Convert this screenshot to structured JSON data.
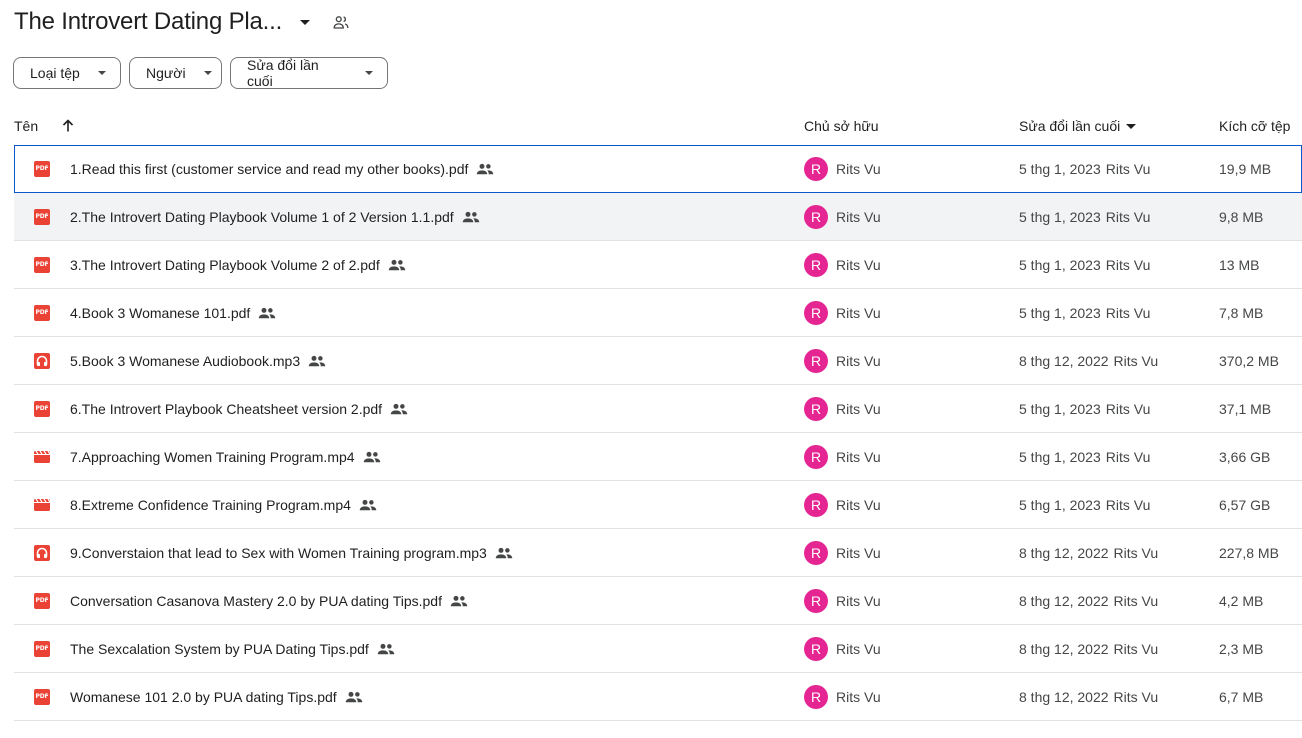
{
  "folder": {
    "title": "The Introvert Dating Pla...",
    "title_caret_icon": "arrow-drop-down-icon",
    "shared_icon": "shared-people-icon"
  },
  "filters": [
    {
      "label": "Loại tệp"
    },
    {
      "label": "Người"
    },
    {
      "label": "Sửa đổi lần cuối"
    }
  ],
  "columns": {
    "name": "Tên",
    "owner": "Chủ sở hữu",
    "modified": "Sửa đổi lần cuối",
    "size": "Kích cỡ tệp"
  },
  "colors": {
    "pdf": "#ea4335",
    "audio": "#ea4335",
    "video": "#ea4335",
    "avatar": "#e52592",
    "selection": "#0b57d0"
  },
  "files": [
    {
      "name": "1.Read this first (customer service and read my other books).pdf",
      "type": "pdf",
      "owner_initial": "R",
      "owner": "Rits Vu",
      "modified_date": "5 thg 1, 2023",
      "modified_by": "Rits Vu",
      "size": "19,9 MB"
    },
    {
      "name": "2.The Introvert Dating Playbook Volume 1 of 2 Version 1.1.pdf",
      "type": "pdf",
      "owner_initial": "R",
      "owner": "Rits Vu",
      "modified_date": "5 thg 1, 2023",
      "modified_by": "Rits Vu",
      "size": "9,8 MB"
    },
    {
      "name": "3.The Introvert Dating Playbook Volume 2 of 2.pdf",
      "type": "pdf",
      "owner_initial": "R",
      "owner": "Rits Vu",
      "modified_date": "5 thg 1, 2023",
      "modified_by": "Rits Vu",
      "size": "13 MB"
    },
    {
      "name": "4.Book 3 Womanese 101.pdf",
      "type": "pdf",
      "owner_initial": "R",
      "owner": "Rits Vu",
      "modified_date": "5 thg 1, 2023",
      "modified_by": "Rits Vu",
      "size": "7,8 MB"
    },
    {
      "name": "5.Book 3 Womanese Audiobook.mp3",
      "type": "audio",
      "owner_initial": "R",
      "owner": "Rits Vu",
      "modified_date": "8 thg 12, 2022",
      "modified_by": "Rits Vu",
      "size": "370,2 MB"
    },
    {
      "name": "6.The Introvert Playbook Cheatsheet version 2.pdf",
      "type": "pdf",
      "owner_initial": "R",
      "owner": "Rits Vu",
      "modified_date": "5 thg 1, 2023",
      "modified_by": "Rits Vu",
      "size": "37,1 MB"
    },
    {
      "name": "7.Approaching Women Training Program.mp4",
      "type": "video",
      "owner_initial": "R",
      "owner": "Rits Vu",
      "modified_date": "5 thg 1, 2023",
      "modified_by": "Rits Vu",
      "size": "3,66 GB"
    },
    {
      "name": "8.Extreme Confidence Training Program.mp4",
      "type": "video",
      "owner_initial": "R",
      "owner": "Rits Vu",
      "modified_date": "5 thg 1, 2023",
      "modified_by": "Rits Vu",
      "size": "6,57 GB"
    },
    {
      "name": "9.Converstaion that lead to Sex with Women Training program.mp3",
      "type": "audio",
      "owner_initial": "R",
      "owner": "Rits Vu",
      "modified_date": "8 thg 12, 2022",
      "modified_by": "Rits Vu",
      "size": "227,8 MB"
    },
    {
      "name": "Conversation Casanova Mastery 2.0 by PUA dating Tips.pdf",
      "type": "pdf",
      "owner_initial": "R",
      "owner": "Rits Vu",
      "modified_date": "8 thg 12, 2022",
      "modified_by": "Rits Vu",
      "size": "4,2 MB"
    },
    {
      "name": "The Sexcalation System by PUA Dating Tips.pdf",
      "type": "pdf",
      "owner_initial": "R",
      "owner": "Rits Vu",
      "modified_date": "8 thg 12, 2022",
      "modified_by": "Rits Vu",
      "size": "2,3 MB"
    },
    {
      "name": "Womanese 101 2.0 by PUA dating Tips.pdf",
      "type": "pdf",
      "owner_initial": "R",
      "owner": "Rits Vu",
      "modified_date": "8 thg 12, 2022",
      "modified_by": "Rits Vu",
      "size": "6,7 MB"
    }
  ]
}
